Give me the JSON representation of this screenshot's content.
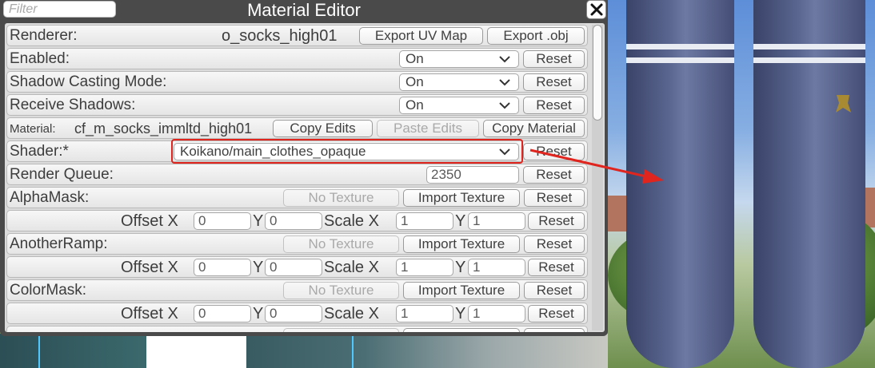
{
  "window": {
    "title": "Material Editor",
    "filter_placeholder": "Filter"
  },
  "renderer": {
    "label": "Renderer:",
    "value": "o_socks_high01",
    "export_uv": "Export UV Map",
    "export_obj": "Export .obj"
  },
  "enabled": {
    "label": "Enabled:",
    "value": "On",
    "reset": "Reset"
  },
  "shadow_casting": {
    "label": "Shadow Casting Mode:",
    "value": "On",
    "reset": "Reset"
  },
  "receive_shadows": {
    "label": "Receive Shadows:",
    "value": "On",
    "reset": "Reset"
  },
  "material": {
    "label": "Material:",
    "value": "cf_m_socks_immltd_high01",
    "copy_edits": "Copy Edits",
    "paste_edits": "Paste Edits",
    "copy_material": "Copy Material"
  },
  "shader": {
    "label": "Shader:*",
    "value": "Koikano/main_clothes_opaque",
    "reset": "Reset"
  },
  "render_queue": {
    "label": "Render Queue:",
    "value": "2350",
    "reset": "Reset"
  },
  "textures": [
    {
      "label": "AlphaMask:",
      "no_texture": "No Texture",
      "import": "Import Texture",
      "reset": "Reset",
      "offset_label": "Offset X",
      "offset_x": "0",
      "y_label": "Y",
      "offset_y": "0",
      "scale_label": "Scale X",
      "scale_x": "1",
      "scale_y_label": "Y",
      "scale_y": "1",
      "reset2": "Reset"
    },
    {
      "label": "AnotherRamp:",
      "no_texture": "No Texture",
      "import": "Import Texture",
      "reset": "Reset",
      "offset_label": "Offset X",
      "offset_x": "0",
      "y_label": "Y",
      "offset_y": "0",
      "scale_label": "Scale X",
      "scale_x": "1",
      "scale_y_label": "Y",
      "scale_y": "1",
      "reset2": "Reset"
    },
    {
      "label": "ColorMask:",
      "no_texture": "No Texture",
      "import": "Import Texture",
      "reset": "Reset",
      "offset_label": "Offset X",
      "offset_x": "0",
      "y_label": "Y",
      "offset_y": "0",
      "scale_label": "Scale X",
      "scale_x": "1",
      "scale_y_label": "Y",
      "scale_y": "1",
      "reset2": "Reset"
    }
  ],
  "colors": {
    "window_bg": "#4a4a4a",
    "panel_bg": "#dcdcdc",
    "highlight": "#e0251f",
    "sock": "#4a5580"
  },
  "icons": {
    "close": "close-icon",
    "dropdown": "chevron-down-icon",
    "annotation": "red-arrow"
  }
}
